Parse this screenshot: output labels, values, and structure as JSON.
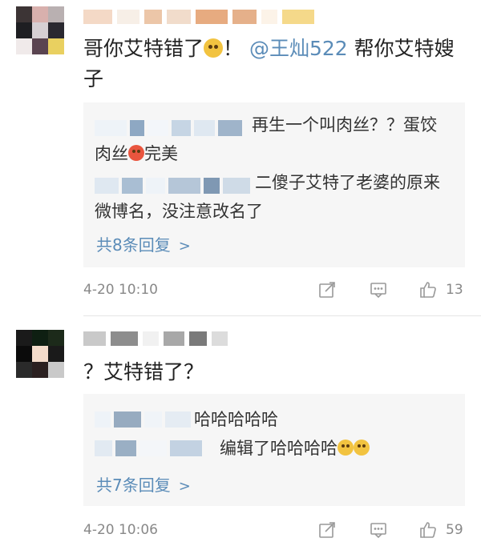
{
  "comments": [
    {
      "text_prefix": "哥你艾特错了",
      "text_mid": "！",
      "mention": "@王灿522",
      "text_suffix": " 帮你艾特嫂子",
      "replies": [
        {
          "text": "再生一个叫肉丝？？蛋饺肉丝",
          "after_emoji": "完美"
        },
        {
          "text": "二傻子艾特了老婆的原来微博名，没注意改名了"
        }
      ],
      "more_label": "共8条回复",
      "time": "4-20 10:10",
      "likes": "13"
    },
    {
      "text": "？艾特错了？",
      "replies": [
        {
          "text": "哈哈哈哈哈"
        },
        {
          "text": "编辑了哈哈哈哈"
        }
      ],
      "more_label": "共7条回复",
      "time": "4-20 10:06",
      "likes": "59"
    }
  ],
  "icons": {
    "forward": "share-icon",
    "comment": "comment-icon",
    "like": "thumbs-up-icon",
    "more": "chevron-right-icon"
  },
  "colors": {
    "link": "#5b8cb8",
    "reply_bg": "#f6f6f6",
    "meta": "#888888"
  }
}
